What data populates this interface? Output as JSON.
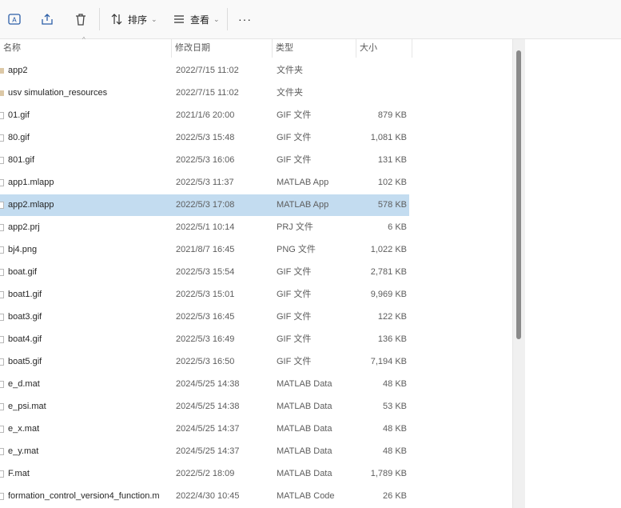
{
  "toolbar": {
    "sort_label": "排序",
    "view_label": "查看",
    "more_label": "···"
  },
  "columns": {
    "name": "名称",
    "date": "修改日期",
    "type": "类型",
    "size": "大小"
  },
  "files": [
    {
      "name": "app2",
      "date": "2022/7/15 11:02",
      "type": "文件夹",
      "size": "",
      "kind": "folder"
    },
    {
      "name": "usv simulation_resources",
      "date": "2022/7/15 11:02",
      "type": "文件夹",
      "size": "",
      "kind": "folder"
    },
    {
      "name": "01.gif",
      "date": "2021/1/6 20:00",
      "type": "GIF 文件",
      "size": "879 KB",
      "kind": "file"
    },
    {
      "name": "80.gif",
      "date": "2022/5/3 15:48",
      "type": "GIF 文件",
      "size": "1,081 KB",
      "kind": "file"
    },
    {
      "name": "801.gif",
      "date": "2022/5/3 16:06",
      "type": "GIF 文件",
      "size": "131 KB",
      "kind": "file"
    },
    {
      "name": "app1.mlapp",
      "date": "2022/5/3 11:37",
      "type": "MATLAB App",
      "size": "102 KB",
      "kind": "file"
    },
    {
      "name": "app2.mlapp",
      "date": "2022/5/3 17:08",
      "type": "MATLAB App",
      "size": "578 KB",
      "kind": "file",
      "selected": true
    },
    {
      "name": "app2.prj",
      "date": "2022/5/1 10:14",
      "type": "PRJ 文件",
      "size": "6 KB",
      "kind": "file"
    },
    {
      "name": "bj4.png",
      "date": "2021/8/7 16:45",
      "type": "PNG 文件",
      "size": "1,022 KB",
      "kind": "file"
    },
    {
      "name": "boat.gif",
      "date": "2022/5/3 15:54",
      "type": "GIF 文件",
      "size": "2,781 KB",
      "kind": "file"
    },
    {
      "name": "boat1.gif",
      "date": "2022/5/3 15:01",
      "type": "GIF 文件",
      "size": "9,969 KB",
      "kind": "file"
    },
    {
      "name": "boat3.gif",
      "date": "2022/5/3 16:45",
      "type": "GIF 文件",
      "size": "122 KB",
      "kind": "file"
    },
    {
      "name": "boat4.gif",
      "date": "2022/5/3 16:49",
      "type": "GIF 文件",
      "size": "136 KB",
      "kind": "file"
    },
    {
      "name": "boat5.gif",
      "date": "2022/5/3 16:50",
      "type": "GIF 文件",
      "size": "7,194 KB",
      "kind": "file"
    },
    {
      "name": "e_d.mat",
      "date": "2024/5/25 14:38",
      "type": "MATLAB Data",
      "size": "48 KB",
      "kind": "file"
    },
    {
      "name": "e_psi.mat",
      "date": "2024/5/25 14:38",
      "type": "MATLAB Data",
      "size": "53 KB",
      "kind": "file"
    },
    {
      "name": "e_x.mat",
      "date": "2024/5/25 14:37",
      "type": "MATLAB Data",
      "size": "48 KB",
      "kind": "file"
    },
    {
      "name": "e_y.mat",
      "date": "2024/5/25 14:37",
      "type": "MATLAB Data",
      "size": "48 KB",
      "kind": "file"
    },
    {
      "name": "F.mat",
      "date": "2022/5/2 18:09",
      "type": "MATLAB Data",
      "size": "1,789 KB",
      "kind": "file"
    },
    {
      "name": "formation_control_version4_function.m",
      "date": "2022/4/30 10:45",
      "type": "MATLAB Code",
      "size": "26 KB",
      "kind": "file"
    }
  ]
}
